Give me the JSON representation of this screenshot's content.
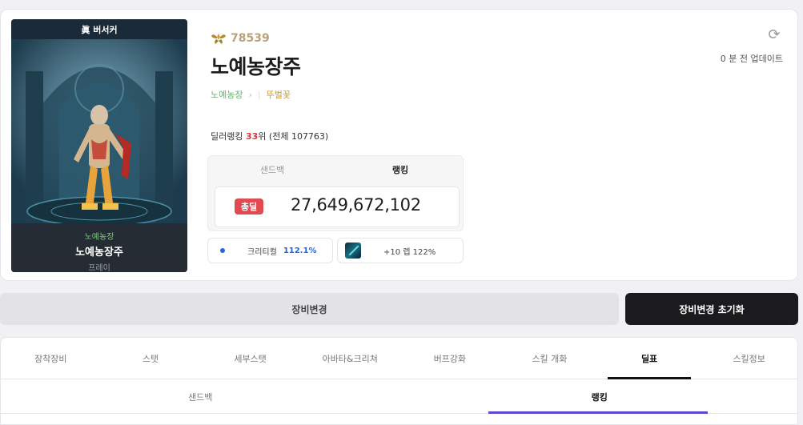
{
  "character": {
    "job_title": "眞 버서커",
    "guild": "노예농장",
    "name": "노예농장주",
    "server": "프레이",
    "fame_icon": "fame-wings-icon",
    "fame": "78539",
    "adventure": "뚜벌꽃"
  },
  "ranking": {
    "prefix": "딜러랭킹 ",
    "rank": "33",
    "suffix": "위 (전체 107763)"
  },
  "update": {
    "refresh_icon": "refresh-icon",
    "text": "0 분 전 업데이트"
  },
  "score": {
    "tab_sandbag": "샌드백",
    "tab_ranking": "랭킹",
    "badge": "총딜",
    "value": "27,649,672,102"
  },
  "stats": {
    "crit_label": "크리티컬",
    "crit_value": "112.1%",
    "enhance_label": "+10 렙 122%"
  },
  "buttons": {
    "change": "장비변경",
    "reset": "장비변경 초기화"
  },
  "tabs": [
    {
      "label": "장착장비",
      "active": false
    },
    {
      "label": "스탯",
      "active": false
    },
    {
      "label": "세부스탯",
      "active": false
    },
    {
      "label": "아바타&크리쳐",
      "active": false
    },
    {
      "label": "버프강화",
      "active": false
    },
    {
      "label": "스킬 개화",
      "active": false
    },
    {
      "label": "딜표",
      "active": true
    },
    {
      "label": "스킬정보",
      "active": false
    }
  ],
  "sub_tabs": [
    {
      "label": "샌드백",
      "active": false
    },
    {
      "label": "랭킹",
      "active": true
    }
  ],
  "colors": {
    "accent_underline": "#5a4ad1",
    "rank_red": "#d9383a",
    "crit_blue": "#2266dd",
    "badge_red": "#e24a52"
  }
}
